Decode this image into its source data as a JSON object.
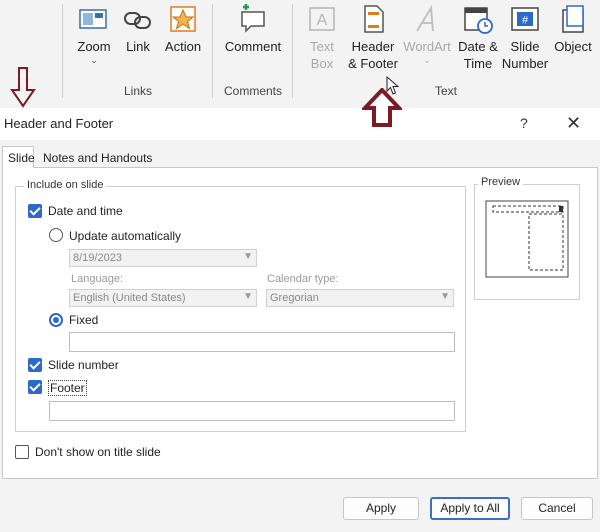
{
  "ribbon": {
    "groups": {
      "links": "Links",
      "comments": "Comments",
      "text": "Text"
    },
    "buttons": {
      "zoom": "Zoom",
      "link": "Link",
      "action": "Action",
      "comment": "Comment",
      "text_box_line1": "Text",
      "text_box_line2": "Box",
      "header_footer_line1": "Header",
      "header_footer_line2": "& Footer",
      "wordart": "WordArt",
      "date_time_line1": "Date &",
      "date_time_line2": "Time",
      "slide_number_line1": "Slide",
      "slide_number_line2": "Number",
      "object": "Object",
      "dropdown_glyph": "⌄"
    },
    "icons": {
      "zoom": "zoom-icon",
      "link": "link-icon",
      "action": "action-star-icon",
      "comment": "comment-icon",
      "text_box": "text-box-icon",
      "header_footer": "header-footer-icon",
      "wordart": "wordart-icon",
      "date_time": "calendar-clock-icon",
      "slide_number": "slide-number-icon",
      "object": "object-icon"
    },
    "slide_number_glyph": "#",
    "text_box_glyph": "A"
  },
  "annotations": {
    "arrow_color": "#7b1c24"
  },
  "dialog": {
    "title": "Header and Footer",
    "help": "?",
    "close": "✕",
    "tabs": [
      "Slide",
      "Notes and Handouts"
    ],
    "include_on_slide": "Include on slide",
    "date_and_time": {
      "label": "Date and time",
      "checked": true
    },
    "update_automatically": {
      "label": "Update automatically",
      "selected": false
    },
    "date_value": "8/19/2023",
    "language_label": "Language:",
    "language_value": "English (United States)",
    "calendar_type_label": "Calendar type:",
    "calendar_type_value": "Gregorian",
    "fixed": {
      "label": "Fixed",
      "selected": true,
      "value": ""
    },
    "slide_number": {
      "label": "Slide number",
      "checked": true
    },
    "footer": {
      "label": "Footer",
      "checked": true,
      "value": ""
    },
    "dont_show_on_title": {
      "label": "Don't show on title slide",
      "checked": false
    },
    "preview_label": "Preview",
    "buttons": {
      "apply": "Apply",
      "apply_to_all": "Apply to All",
      "cancel": "Cancel"
    },
    "accent_color": "#2a6ac8"
  }
}
